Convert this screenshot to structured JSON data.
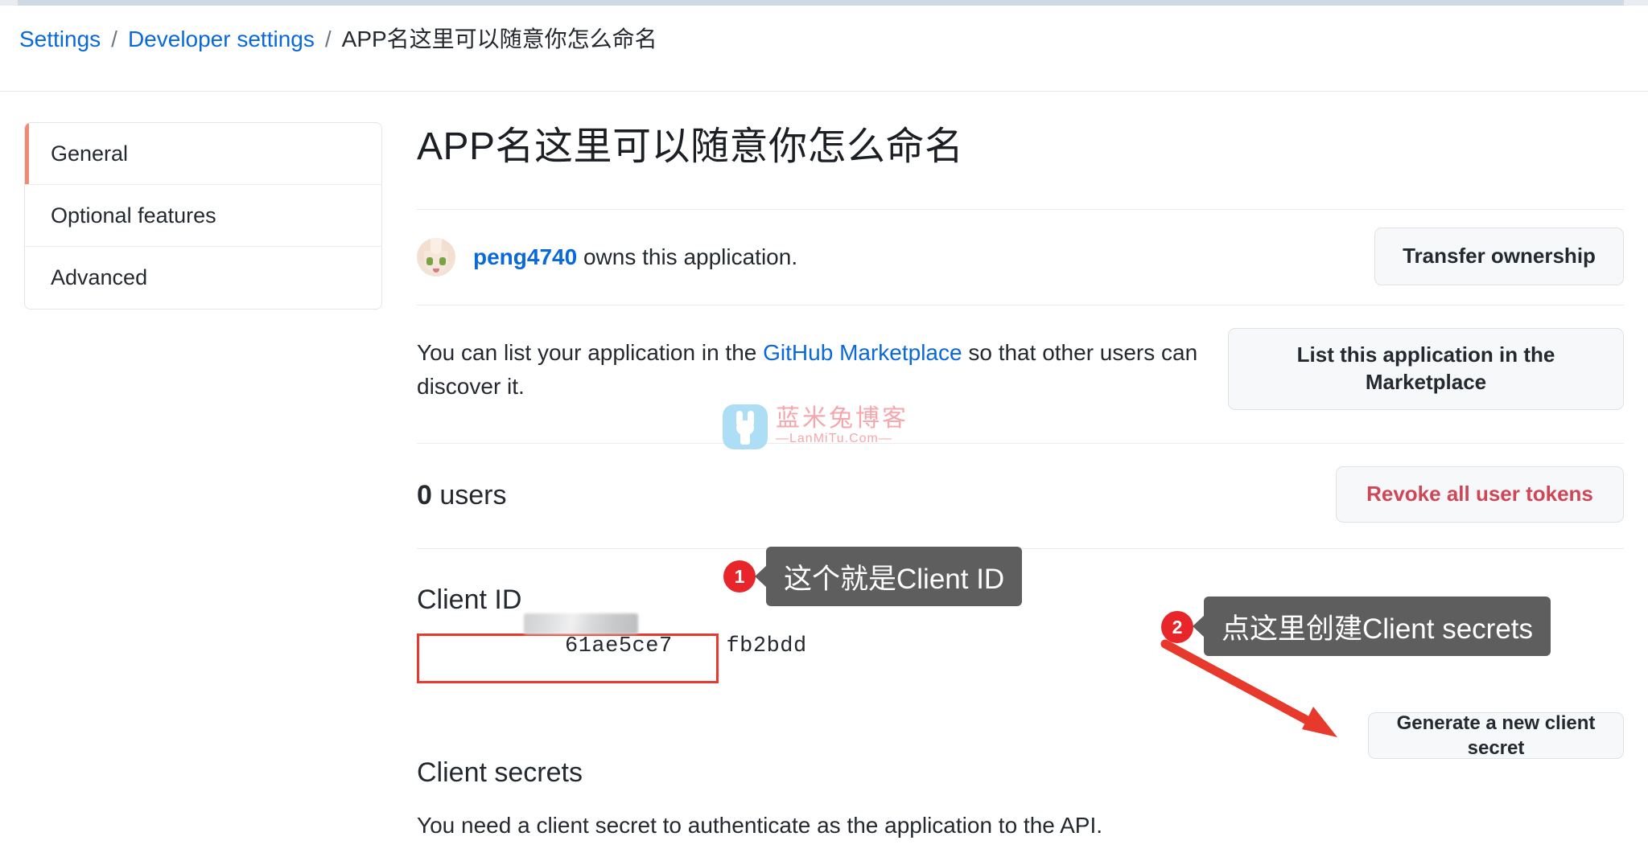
{
  "breadcrumb": {
    "settings": "Settings",
    "developer_settings": "Developer settings",
    "separator": "/",
    "current": "APP名这里可以随意你怎么命名"
  },
  "sidebar": {
    "items": [
      {
        "label": "General",
        "active": true
      },
      {
        "label": "Optional features",
        "active": false
      },
      {
        "label": "Advanced",
        "active": false
      }
    ],
    "active_accent_color": "#f08a73"
  },
  "main": {
    "app_title": "APP名这里可以随意你怎么命名",
    "owner": {
      "username": "peng4740",
      "suffix_text": " owns this application.",
      "avatar_name": "peng4740-avatar",
      "transfer_button": "Transfer ownership"
    },
    "marketplace": {
      "text_before": "You can list your application in the ",
      "link": "GitHub Marketplace",
      "text_after": " so that other users can discover it.",
      "button": "List this application in the Marketplace"
    },
    "users": {
      "count": "0",
      "label": " users",
      "revoke_button": "Revoke all user tokens",
      "revoke_color": "#cf4757"
    },
    "client_id": {
      "heading": "Client ID",
      "value_prefix": "61ae5ce7",
      "value_suffix": "fb2bdd",
      "redacted": true,
      "highlight_color": "#e8392d"
    },
    "client_secrets": {
      "heading": "Client secrets",
      "description": "You need a client secret to authenticate as the application to the API.",
      "generate_button": "Generate a new client secret"
    }
  },
  "annotations": [
    {
      "number": "1",
      "text": "这个就是Client ID"
    },
    {
      "number": "2",
      "text": "点这里创建Client secrets"
    }
  ],
  "annotation_colors": {
    "badge": "#e8252a",
    "bubble": "#5e5e5e",
    "arrow": "#e8392d"
  },
  "watermark": {
    "cn_text": "蓝米兔博客",
    "en_text": "—LanMiTu.Com—",
    "logo_color": "#a8dcf5",
    "text_color": "#f5a0a6"
  }
}
